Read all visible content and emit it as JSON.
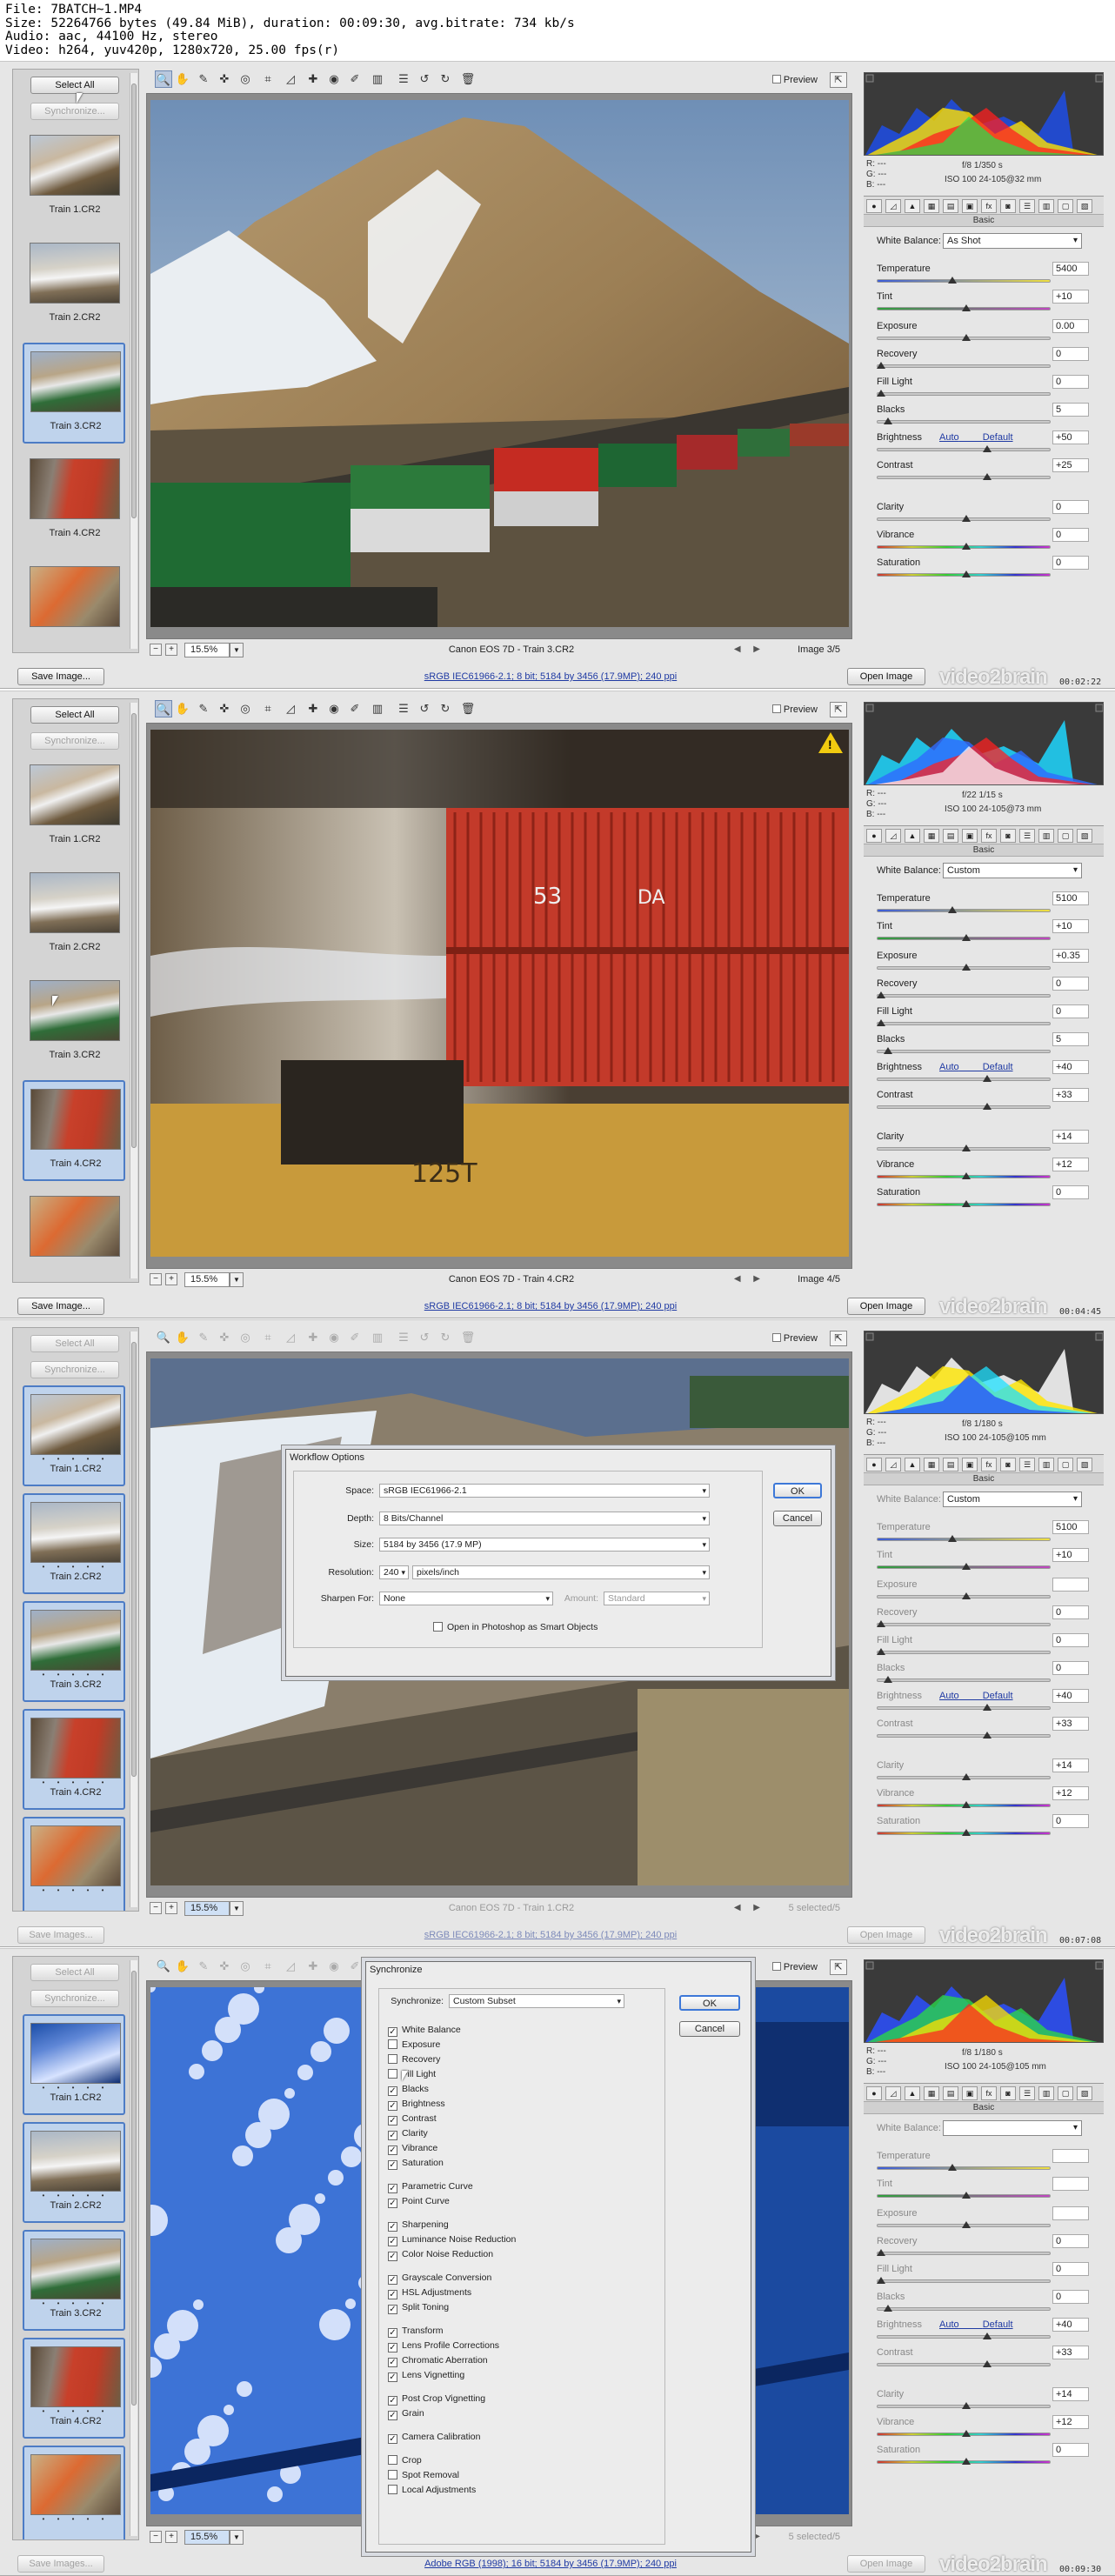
{
  "file_info": {
    "line1": "File: 7BATCH~1.MP4",
    "line2": "Size: 52264766 bytes (49.84 MiB), duration: 00:09:30, avg.bitrate: 734 kb/s",
    "line3": "Audio: aac, 44100 Hz, stereo",
    "line4": "Video: h264, yuv420p, 1280x720, 25.00 fps(r)"
  },
  "common": {
    "select_all": "Select All",
    "synchronize": "Synchronize...",
    "preview": "Preview",
    "basic": "Basic",
    "wb_label": "White Balance:",
    "auto": "Auto",
    "default": "Default",
    "open_image": "Open Image",
    "watermark": "video2brain",
    "zoom": "15.5%",
    "rgb_r": "R:  ---",
    "rgb_g": "G:  ---",
    "rgb_b": "B:  ---"
  },
  "frames": [
    {
      "time": "00:02:22",
      "thumbs": [
        "Train 1.CR2",
        "Train 2.CR2",
        "Train 3.CR2",
        "Train 4.CR2",
        ""
      ],
      "selected": [
        2
      ],
      "save_label": "Save Image...",
      "camera": "Canon EOS 7D  -  Train 3.CR2",
      "count": "Image 3/5",
      "link": "sRGB IEC61966-2.1; 8 bit; 5184 by 3456 (17.9MP); 240 ppi",
      "exif1": "f/8    1/350 s",
      "exif2": "ISO 100   24-105@32 mm",
      "wb": "As Shot",
      "sliders": [
        {
          "label": "Temperature",
          "value": "5400"
        },
        {
          "label": "Tint",
          "value": "+10"
        },
        {
          "label": "Exposure",
          "value": "0.00"
        },
        {
          "label": "Recovery",
          "value": "0"
        },
        {
          "label": "Fill Light",
          "value": "0"
        },
        {
          "label": "Blacks",
          "value": "5"
        },
        {
          "label": "Brightness",
          "value": "+50"
        },
        {
          "label": "Contrast",
          "value": "+25"
        },
        {
          "label": "Clarity",
          "value": "0"
        },
        {
          "label": "Vibrance",
          "value": "0"
        },
        {
          "label": "Saturation",
          "value": "0"
        }
      ]
    },
    {
      "time": "00:04:45",
      "thumbs": [
        "Train 1.CR2",
        "Train 2.CR2",
        "Train 3.CR2",
        "Train 4.CR2",
        ""
      ],
      "selected": [
        3
      ],
      "save_label": "Save Image...",
      "camera": "Canon EOS 7D  -  Train 4.CR2",
      "count": "Image 4/5",
      "link": "sRGB IEC61966-2.1; 8 bit; 5184 by 3456 (17.9MP); 240 ppi",
      "exif1": "f/22   1/15 s",
      "exif2": "ISO 100   24-105@73 mm",
      "wb": "Custom",
      "sliders": [
        {
          "label": "Temperature",
          "value": "5100"
        },
        {
          "label": "Tint",
          "value": "+10"
        },
        {
          "label": "Exposure",
          "value": "+0.35"
        },
        {
          "label": "Recovery",
          "value": "0"
        },
        {
          "label": "Fill Light",
          "value": "0"
        },
        {
          "label": "Blacks",
          "value": "5"
        },
        {
          "label": "Brightness",
          "value": "+40"
        },
        {
          "label": "Contrast",
          "value": "+33"
        },
        {
          "label": "Clarity",
          "value": "+14"
        },
        {
          "label": "Vibrance",
          "value": "+12"
        },
        {
          "label": "Saturation",
          "value": "0"
        }
      ]
    },
    {
      "time": "00:07:08",
      "thumbs": [
        "Train 1.CR2",
        "Train 2.CR2",
        "Train 3.CR2",
        "Train 4.CR2",
        ""
      ],
      "selected": [
        0
      ],
      "save_label": "Save Images...",
      "camera": "Canon EOS 7D  -  Train 1.CR2",
      "count": "5 selected/5",
      "link": "sRGB IEC61966-2.1; 8 bit; 5184 by 3456 (17.9MP); 240 ppi",
      "exif1": "f/8    1/180 s",
      "exif2": "ISO 100   24-105@105 mm",
      "wb": "Custom",
      "sliders": [
        {
          "label": "Temperature",
          "value": "5100"
        },
        {
          "label": "Tint",
          "value": "+10"
        },
        {
          "label": "Exposure",
          "value": ""
        },
        {
          "label": "Recovery",
          "value": "0"
        },
        {
          "label": "Fill Light",
          "value": "0"
        },
        {
          "label": "Blacks",
          "value": "0"
        },
        {
          "label": "Brightness",
          "value": "+40"
        },
        {
          "label": "Contrast",
          "value": "+33"
        },
        {
          "label": "Clarity",
          "value": "+14"
        },
        {
          "label": "Vibrance",
          "value": "+12"
        },
        {
          "label": "Saturation",
          "value": "0"
        }
      ]
    },
    {
      "time": "00:09:30",
      "thumbs": [
        "Train 1.CR2",
        "Train 2.CR2",
        "Train 3.CR2",
        "Train 4.CR2",
        ""
      ],
      "selected": [
        0
      ],
      "save_label": "Save Images...",
      "camera": "",
      "count": "5 selected/5",
      "link": "Adobe RGB (1998); 16 bit; 5184 by 3456 (17.9MP); 240 ppi",
      "exif1": "f/8    1/180 s",
      "exif2": "ISO 100   24-105@105 mm",
      "wb": "",
      "sliders": [
        {
          "label": "Temperature",
          "value": ""
        },
        {
          "label": "Tint",
          "value": ""
        },
        {
          "label": "Exposure",
          "value": ""
        },
        {
          "label": "Recovery",
          "value": "0"
        },
        {
          "label": "Fill Light",
          "value": "0"
        },
        {
          "label": "Blacks",
          "value": "0"
        },
        {
          "label": "Brightness",
          "value": "+40"
        },
        {
          "label": "Contrast",
          "value": "+33"
        },
        {
          "label": "Clarity",
          "value": "+14"
        },
        {
          "label": "Vibrance",
          "value": "+12"
        },
        {
          "label": "Saturation",
          "value": "0"
        }
      ]
    }
  ],
  "workflow": {
    "title": "Workflow Options",
    "space_label": "Space:",
    "space": "sRGB IEC61966-2.1",
    "depth_label": "Depth:",
    "depth": "8 Bits/Channel",
    "size_label": "Size:",
    "size": "5184 by 3456  (17.9 MP)",
    "res_label": "Resolution:",
    "res": "240",
    "res_unit": "pixels/inch",
    "sharpen_label": "Sharpen For:",
    "sharpen": "None",
    "amount_label": "Amount:",
    "amount": "Standard",
    "smart": "Open in Photoshop as Smart Objects",
    "ok": "OK",
    "cancel": "Cancel"
  },
  "sync": {
    "title": "Synchronize",
    "label": "Synchronize:",
    "value": "Custom Subset",
    "ok": "OK",
    "cancel": "Cancel",
    "items": [
      {
        "t": "White Balance",
        "c": true
      },
      {
        "t": "Exposure",
        "c": false
      },
      {
        "t": "Recovery",
        "c": false
      },
      {
        "t": "Fill Light",
        "c": false
      },
      {
        "t": "Blacks",
        "c": true
      },
      {
        "t": "Brightness",
        "c": true
      },
      {
        "t": "Contrast",
        "c": true
      },
      {
        "t": "Clarity",
        "c": true
      },
      {
        "t": "Vibrance",
        "c": true
      },
      {
        "t": "Saturation",
        "c": true
      },
      {
        "gap": true
      },
      {
        "t": "Parametric Curve",
        "c": true
      },
      {
        "t": "Point Curve",
        "c": true
      },
      {
        "gap": true
      },
      {
        "t": "Sharpening",
        "c": true
      },
      {
        "t": "Luminance Noise Reduction",
        "c": true
      },
      {
        "t": "Color Noise Reduction",
        "c": true
      },
      {
        "gap": true
      },
      {
        "t": "Grayscale Conversion",
        "c": true
      },
      {
        "t": "HSL Adjustments",
        "c": true
      },
      {
        "t": "Split Toning",
        "c": true
      },
      {
        "gap": true
      },
      {
        "t": "Transform",
        "c": true
      },
      {
        "t": "Lens Profile Corrections",
        "c": true
      },
      {
        "t": "Chromatic Aberration",
        "c": true
      },
      {
        "t": "Lens Vignetting",
        "c": true
      },
      {
        "gap": true
      },
      {
        "t": "Post Crop Vignetting",
        "c": true
      },
      {
        "t": "Grain",
        "c": true
      },
      {
        "gap": true
      },
      {
        "t": "Camera Calibration",
        "c": true
      },
      {
        "gap": true
      },
      {
        "t": "Crop",
        "c": false
      },
      {
        "t": "Spot Removal",
        "c": false
      },
      {
        "t": "Local Adjustments",
        "c": false
      }
    ]
  }
}
